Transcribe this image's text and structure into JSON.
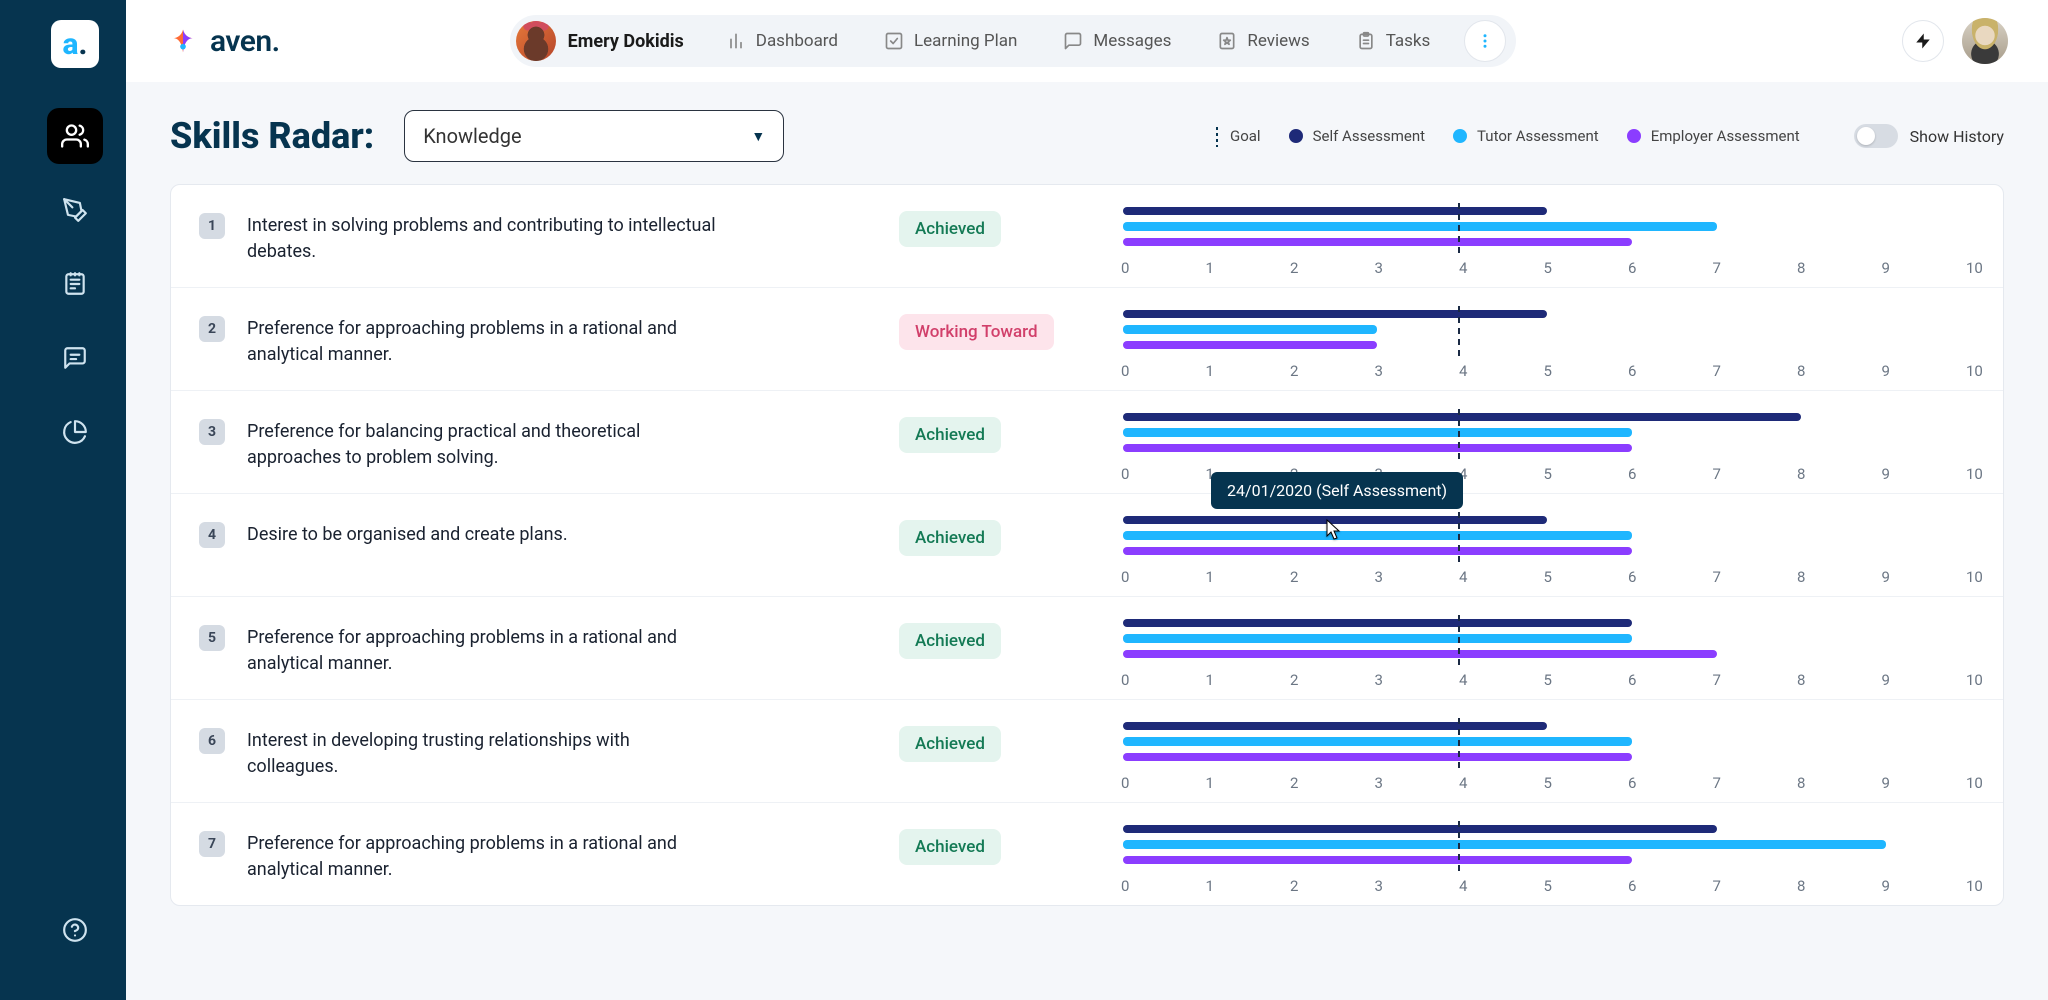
{
  "brand": {
    "name": "aven."
  },
  "user": {
    "name": "Emery Dokidis"
  },
  "nav": [
    {
      "icon": "bar-chart",
      "label": "Dashboard"
    },
    {
      "icon": "check-square",
      "label": "Learning Plan"
    },
    {
      "icon": "message",
      "label": "Messages"
    },
    {
      "icon": "star-doc",
      "label": "Reviews"
    },
    {
      "icon": "clipboard",
      "label": "Tasks"
    }
  ],
  "page": {
    "title": "Skills Radar:",
    "filter": "Knowledge"
  },
  "legend": {
    "goal": "Goal",
    "self": "Self Assessment",
    "tutor": "Tutor Assessment",
    "employer": "Employer Assessment",
    "colors": {
      "self": "#1e2a78",
      "tutor": "#1fb6ff",
      "employer": "#8b3dff"
    }
  },
  "history_toggle": "Show History",
  "status_labels": {
    "achieved": "Achieved",
    "working": "Working Toward"
  },
  "axis": [
    "0",
    "1",
    "2",
    "3",
    "4",
    "5",
    "6",
    "7",
    "8",
    "9",
    "10"
  ],
  "tooltip": "24/01/2020 (Self Assessment)",
  "skills": [
    {
      "n": "1",
      "text": "Interest in solving problems and contributing to intellectual debates.",
      "status": "achieved",
      "goal": 4,
      "self": 5,
      "tutor": 7,
      "employer": 6
    },
    {
      "n": "2",
      "text": "Preference for approaching problems in a rational and analytical manner.",
      "status": "working",
      "goal": 4,
      "self": 5,
      "tutor": 3,
      "employer": 3
    },
    {
      "n": "3",
      "text": "Preference for balancing practical and theoretical approaches to problem solving.",
      "status": "achieved",
      "goal": 4,
      "self": 8,
      "tutor": 6,
      "employer": 6
    },
    {
      "n": "4",
      "text": "Desire to be organised and create plans.",
      "status": "achieved",
      "goal": 4,
      "self": 5,
      "tutor": 6,
      "employer": 6
    },
    {
      "n": "5",
      "text": "Preference for approaching problems in a rational and analytical manner.",
      "status": "achieved",
      "goal": 4,
      "self": 6,
      "tutor": 6,
      "employer": 7
    },
    {
      "n": "6",
      "text": "Interest in developing trusting relationships with colleagues.",
      "status": "achieved",
      "goal": 4,
      "self": 5,
      "tutor": 6,
      "employer": 6
    },
    {
      "n": "7",
      "text": "Preference for approaching problems in a rational and analytical manner.",
      "status": "achieved",
      "goal": 4,
      "self": 7,
      "tutor": 9,
      "employer": 6
    }
  ],
  "chart_data": {
    "type": "bar",
    "orientation": "horizontal",
    "xlim": [
      0,
      10
    ],
    "xticks": [
      0,
      1,
      2,
      3,
      4,
      5,
      6,
      7,
      8,
      9,
      10
    ],
    "series_names": [
      "Self Assessment",
      "Tutor Assessment",
      "Employer Assessment"
    ],
    "goal_marker": true,
    "rows": [
      {
        "label": "Interest in solving problems and contributing to intellectual debates.",
        "goal": 4,
        "values": {
          "Self Assessment": 5,
          "Tutor Assessment": 7,
          "Employer Assessment": 6
        }
      },
      {
        "label": "Preference for approaching problems in a rational and analytical manner.",
        "goal": 4,
        "values": {
          "Self Assessment": 5,
          "Tutor Assessment": 3,
          "Employer Assessment": 3
        }
      },
      {
        "label": "Preference for balancing practical and theoretical approaches to problem solving.",
        "goal": 4,
        "values": {
          "Self Assessment": 8,
          "Tutor Assessment": 6,
          "Employer Assessment": 6
        }
      },
      {
        "label": "Desire to be organised and create plans.",
        "goal": 4,
        "values": {
          "Self Assessment": 5,
          "Tutor Assessment": 6,
          "Employer Assessment": 6
        }
      },
      {
        "label": "Preference for approaching problems in a rational and analytical manner.",
        "goal": 4,
        "values": {
          "Self Assessment": 6,
          "Tutor Assessment": 6,
          "Employer Assessment": 7
        }
      },
      {
        "label": "Interest in developing trusting relationships with colleagues.",
        "goal": 4,
        "values": {
          "Self Assessment": 5,
          "Tutor Assessment": 6,
          "Employer Assessment": 6
        }
      },
      {
        "label": "Preference for approaching problems in a rational and analytical manner.",
        "goal": 4,
        "values": {
          "Self Assessment": 7,
          "Tutor Assessment": 9,
          "Employer Assessment": 6
        }
      }
    ]
  }
}
